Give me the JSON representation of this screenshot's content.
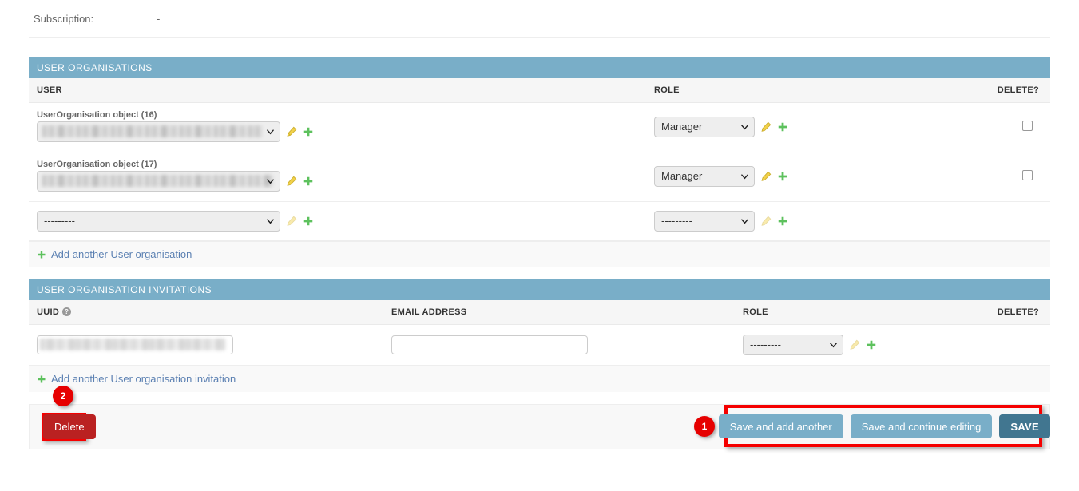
{
  "top_field": {
    "label": "Subscription:",
    "value": "-"
  },
  "user_organisations": {
    "title": "USER ORGANISATIONS",
    "columns": {
      "user": "USER",
      "role": "ROLE",
      "delete": "DELETE?"
    },
    "rows": [
      {
        "caption": "UserOrganisation object (16)",
        "user_value": "",
        "role_value": "Manager",
        "delete_checked": false,
        "has_delete": true,
        "pencil_enabled": true
      },
      {
        "caption": "UserOrganisation object (17)",
        "user_value": "",
        "role_value": "Manager",
        "delete_checked": false,
        "has_delete": true,
        "pencil_enabled": true
      },
      {
        "caption": "",
        "user_value": "---------",
        "role_value": "---------",
        "delete_checked": false,
        "has_delete": false,
        "pencil_enabled": false
      }
    ],
    "add_another_label": "Add another User organisation"
  },
  "user_organisation_invitations": {
    "title": "USER ORGANISATION INVITATIONS",
    "columns": {
      "uuid": "UUID",
      "uuid_help_icon": "help-icon",
      "email": "EMAIL ADDRESS",
      "role": "ROLE",
      "delete": "DELETE?"
    },
    "rows": [
      {
        "uuid_value": "",
        "email_value": "",
        "email_placeholder": "",
        "role_value": "---------"
      }
    ],
    "add_another_label": "Add another User organisation invitation"
  },
  "submit_row": {
    "delete_label": "Delete",
    "save_and_add_another_label": "Save and add another",
    "save_and_continue_label": "Save and continue editing",
    "save_label": "SAVE"
  },
  "annotations": [
    {
      "number": "1"
    },
    {
      "number": "2"
    }
  ],
  "icons": {
    "pencil": "pencil-icon",
    "plus": "plus-icon",
    "chevron_down": "chevron-down-icon"
  },
  "colors": {
    "header_blue": "#79aec8",
    "save_dark": "#417690",
    "delete_red": "#ba2121",
    "annotation_red": "#f50000",
    "link_blue": "#5b80b2"
  }
}
